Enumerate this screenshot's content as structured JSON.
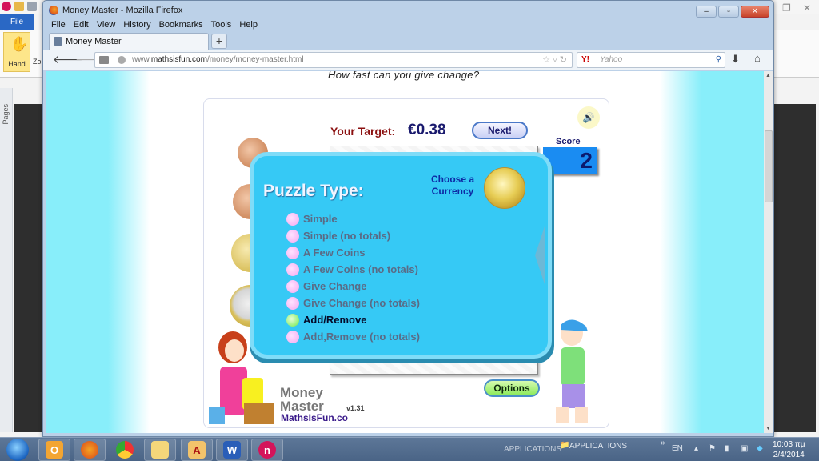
{
  "background_app": {
    "file_tab": "File",
    "hand_tool": "Hand",
    "zoom_tool_partial": "Zo",
    "side_panel": "Pages"
  },
  "browser": {
    "window_title": "Money Master - Mozilla Firefox",
    "menu": [
      "File",
      "Edit",
      "View",
      "History",
      "Bookmarks",
      "Tools",
      "Help"
    ],
    "tab_title": "Money Master",
    "new_tab": "+",
    "url_prefix": "www.",
    "url_domain": "mathsisfun.com",
    "url_path": "/money/money-master.html",
    "search_placeholder": "Yahoo",
    "search_engine": "Y!"
  },
  "page": {
    "tagline": "How fast can you give change?"
  },
  "game": {
    "target_label": "Your Target:",
    "target_value": "€0.38",
    "next_button": "Next!",
    "score_label": "Score",
    "score_value": "2",
    "options_button": "Options",
    "logo_line1": "Money",
    "logo_line2": "Master",
    "site": "MathsIsFun.co",
    "version": "v1.31",
    "coins": [
      "1 cent",
      "5 cent",
      "20 cent",
      "1 euro"
    ]
  },
  "puzzle_panel": {
    "title": "Puzzle Type:",
    "currency_label_1": "Choose a",
    "currency_label_2": "Currency",
    "options": [
      {
        "label": "Simple",
        "selected": false
      },
      {
        "label": "Simple (no totals)",
        "selected": false
      },
      {
        "label": "A Few Coins",
        "selected": false
      },
      {
        "label": "A Few Coins (no totals)",
        "selected": false
      },
      {
        "label": "Give Change",
        "selected": false
      },
      {
        "label": "Give Change (no totals)",
        "selected": false
      },
      {
        "label": "Add/Remove",
        "selected": true
      },
      {
        "label": "Add,Remove (no totals)",
        "selected": false
      }
    ]
  },
  "taskbar": {
    "apps": [
      "Outlook",
      "Firefox",
      "Chrome",
      "Explorer",
      "Adobe Reader",
      "Word",
      "App"
    ],
    "toolbar_1": "APPLICATIONS",
    "toolbar_2": "APPLICATIONS",
    "overflow": "»",
    "language": "EN",
    "time": "10:03 πμ",
    "date": "2/4/2014"
  },
  "colors": {
    "panel": "#36c9f5",
    "score_box": "#1a8cf2",
    "target_label": "#8b1010",
    "selected_dot": "#6be84a",
    "unselected_dot": "#f4a6f0"
  }
}
